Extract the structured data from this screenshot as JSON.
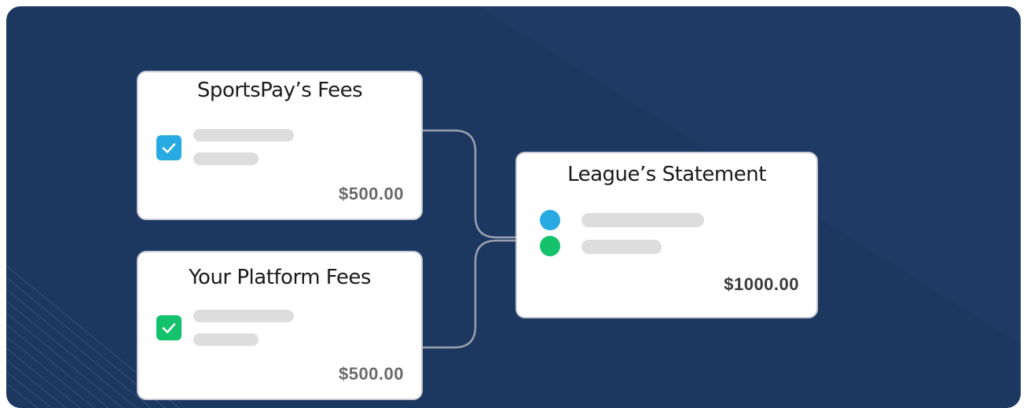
{
  "colors": {
    "background": "#1c3760",
    "card_border": "#c9ccd3",
    "connector": "#9aa1ad",
    "blue": "#27a9e1",
    "green": "#13c26b",
    "placeholder": "#dddddd"
  },
  "cards": {
    "sportspay": {
      "title": "SportsPay’s Fees",
      "amount": "$500.00",
      "check_icon": "checkmark-icon"
    },
    "platform": {
      "title": "Your Platform Fees",
      "amount": "$500.00",
      "check_icon": "checkmark-icon"
    },
    "statement": {
      "title": "League’s Statement",
      "amount": "$1000.00"
    }
  }
}
